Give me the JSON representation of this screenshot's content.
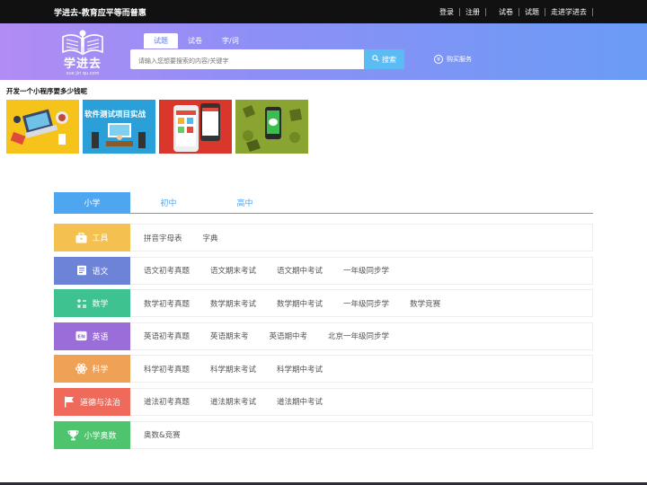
{
  "topbar": {
    "slogan": "学进去-教育应平等而普惠",
    "links": [
      "登录",
      "注册",
      "试卷",
      "试题",
      "走进学进去"
    ]
  },
  "header": {
    "logo_name": "学进去",
    "logo_url": "xue jin qu.com",
    "search_tabs": [
      "试题",
      "试卷",
      "字/词"
    ],
    "active_search_tab": "试题",
    "search_placeholder": "请输入您想要搜索的内容/关键字",
    "search_button": "搜索",
    "buy_service": "购买服务",
    "colors": {
      "gradient_start": "#b18cf4",
      "gradient_end": "#6a9cf5",
      "search_button": "#5bbcf4"
    }
  },
  "promo": {
    "title": "开发一个小程序要多少钱呢",
    "images": [
      {
        "icon": "laptop-desk-illustration"
      },
      {
        "caption": "软件测试项目实战",
        "icon": "classroom-illustration"
      },
      {
        "icon": "mobile-app-screens-illustration"
      },
      {
        "icon": "wechat-phone-illustration"
      }
    ]
  },
  "grade_tabs": [
    "小学",
    "初中",
    "高中"
  ],
  "active_grade": "小学",
  "subjects": [
    {
      "name": "工具",
      "color": "#f4c150",
      "icon": "toolbox-icon",
      "items": [
        "拼音字母表",
        "字典"
      ]
    },
    {
      "name": "语文",
      "color": "#6c83d8",
      "icon": "book-icon",
      "items": [
        "语文初考真题",
        "语文期末考试",
        "语文期中考试",
        "一年级同步学"
      ]
    },
    {
      "name": "数学",
      "color": "#3ec28f",
      "icon": "math-symbols-icon",
      "items": [
        "数学初考真题",
        "数学期末考试",
        "数学期中考试",
        "一年级同步学",
        "数学竞赛"
      ]
    },
    {
      "name": "英语",
      "color": "#9a6dd8",
      "icon": "en-badge-icon",
      "items": [
        "英语初考真题",
        "英语期末考",
        "英语期中考",
        "北京一年级同步学"
      ]
    },
    {
      "name": "科学",
      "color": "#efa256",
      "icon": "atom-icon",
      "items": [
        "科学初考真题",
        "科学期末考试",
        "科学期中考试"
      ]
    },
    {
      "name": "道德与法治",
      "color": "#ef6a5a",
      "icon": "flag-icon",
      "items": [
        "道法初考真题",
        "道法期末考试",
        "道法期中考试"
      ]
    },
    {
      "name": "小学奥数",
      "color": "#4fc46e",
      "icon": "trophy-icon",
      "items": [
        "奥数&竞赛"
      ]
    }
  ]
}
